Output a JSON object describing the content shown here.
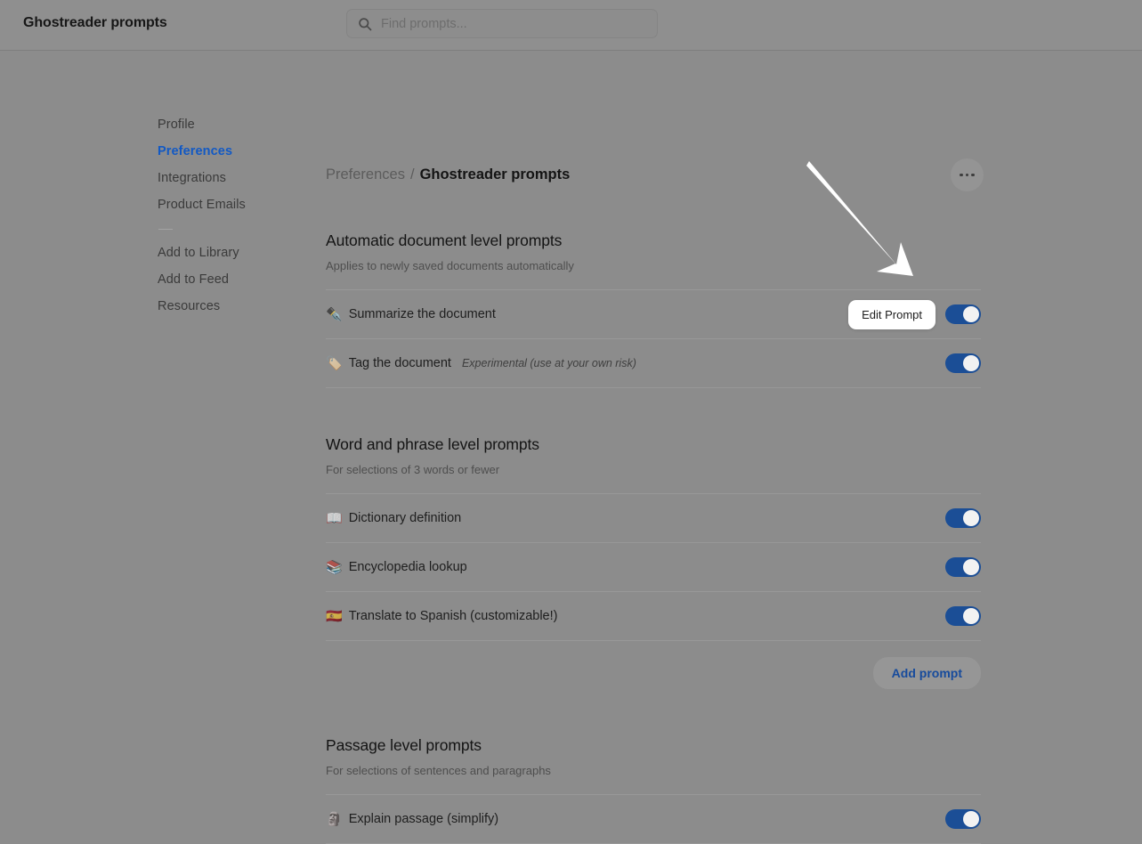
{
  "header": {
    "title": "Ghostreader prompts",
    "search": {
      "placeholder": "Find prompts...",
      "value": "",
      "icon": "search-icon"
    }
  },
  "sidebar": {
    "items": [
      {
        "label": "Profile",
        "active": false
      },
      {
        "label": "Preferences",
        "active": true
      },
      {
        "label": "Integrations",
        "active": false
      },
      {
        "label": "Product Emails",
        "active": false
      },
      {
        "label": "Add to Library",
        "active": false
      },
      {
        "label": "Add to Feed",
        "active": false
      },
      {
        "label": "Resources",
        "active": false
      }
    ]
  },
  "breadcrumb": {
    "parent": "Preferences",
    "separator": "/",
    "current": "Ghostreader prompts"
  },
  "more_menu": {
    "label": "more-options",
    "icon": "ellipsis-icon"
  },
  "sections": [
    {
      "title": "Automatic document level prompts",
      "subtitle": "Applies to newly saved documents automatically",
      "rows": [
        {
          "emoji": "✒️",
          "icon_name": "fountain-pen-icon",
          "label": "Summarize the document",
          "note": "",
          "toggle_on": true,
          "action_label": "Edit Prompt",
          "has_action": true
        },
        {
          "emoji": "🏷️",
          "icon_name": "label-tag-icon",
          "label": "Tag the document",
          "note": "Experimental (use at your own risk)",
          "toggle_on": true,
          "action_label": "",
          "has_action": false
        }
      ],
      "add_button": ""
    },
    {
      "title": "Word and phrase level prompts",
      "subtitle": "For selections of 3 words or fewer",
      "rows": [
        {
          "emoji": "📖",
          "icon_name": "open-book-icon",
          "label": "Dictionary definition",
          "note": "",
          "toggle_on": true,
          "action_label": "",
          "has_action": false
        },
        {
          "emoji": "📚",
          "icon_name": "books-icon",
          "label": "Encyclopedia lookup",
          "note": "",
          "toggle_on": true,
          "action_label": "",
          "has_action": false
        },
        {
          "emoji": "🇪🇸",
          "icon_name": "spain-flag-icon",
          "label": "Translate to Spanish (customizable!)",
          "note": "",
          "toggle_on": true,
          "action_label": "",
          "has_action": false
        }
      ],
      "add_button": "Add prompt"
    },
    {
      "title": "Passage level prompts",
      "subtitle": "For selections of sentences and paragraphs",
      "rows": [
        {
          "emoji": "🗿",
          "icon_name": "moai-icon",
          "label": "Explain passage (simplify)",
          "note": "",
          "toggle_on": true,
          "action_label": "",
          "has_action": false
        }
      ],
      "add_button": ""
    }
  ],
  "annotation": {
    "name": "pointer-arrow",
    "points_to": "Edit Prompt"
  },
  "colors": {
    "accent_blue": "#1259c4",
    "toggle_on": "#1b4e96",
    "link_blue": "#174b9c",
    "page_background": "#8c8c8c"
  }
}
